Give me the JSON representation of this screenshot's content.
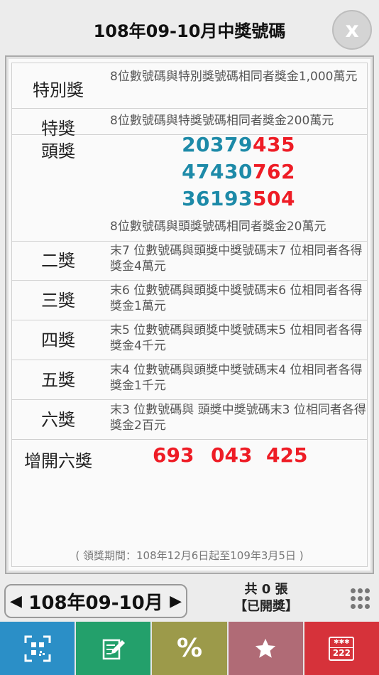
{
  "header": {
    "title": "108年09-10月中獎號碼",
    "close_label": "x"
  },
  "prizes": {
    "special": {
      "label": "特別獎",
      "desc": "8位數號碼與特別獎號碼相同者獎金1,000萬元"
    },
    "grand": {
      "label": "特獎",
      "desc": "8位數號碼與特獎號碼相同者獎金200萬元"
    },
    "first": {
      "label": "頭獎",
      "numbers": [
        {
          "blue": "20379",
          "red": "435"
        },
        {
          "blue": "47430",
          "red": "762"
        },
        {
          "blue": "36193",
          "red": "504"
        }
      ],
      "desc": "8位數號碼與頭獎號碼相同者獎金20萬元"
    },
    "second": {
      "label": "二獎",
      "desc": "末7 位數號碼與頭獎中獎號碼末7 位相同者各得獎金4萬元"
    },
    "third": {
      "label": "三獎",
      "desc": "末6 位數號碼與頭獎中獎號碼末6 位相同者各得獎金1萬元"
    },
    "fourth": {
      "label": "四獎",
      "desc": "末5 位數號碼與頭獎中獎號碼末5 位相同者各得獎金4千元"
    },
    "fifth": {
      "label": "五獎",
      "desc": "末4 位數號碼與頭獎中獎號碼末4 位相同者各得獎金1千元"
    },
    "sixth": {
      "label": "六獎",
      "desc": "末3 位數號碼與 頭獎中獎號碼末3 位相同者各得獎金2百元"
    },
    "extra_sixth": {
      "label": "增開六獎",
      "numbers": [
        "693",
        "043",
        "425"
      ]
    }
  },
  "claim_period": "( 領獎期間：108年12月6日起至109年3月5日 )",
  "footer": {
    "prev_arrow": "◀",
    "period": "108年09-10月",
    "next_arrow": "▶",
    "count_line": "共 0 張",
    "status": "【已開獎】"
  },
  "toolbar": {
    "items": [
      {
        "name": "qr-scan-icon",
        "color": "#2b8fc7"
      },
      {
        "name": "edit-icon",
        "color": "#23a06b"
      },
      {
        "name": "percent-icon",
        "color": "#9c9a4a",
        "text": "%"
      },
      {
        "name": "star-icon",
        "color": "#b06b76"
      },
      {
        "name": "lottery-icon",
        "color": "#d6323a",
        "text": "222"
      }
    ]
  },
  "colors": {
    "number_blue": "#1d8aa8",
    "number_red": "#ee1c25"
  }
}
